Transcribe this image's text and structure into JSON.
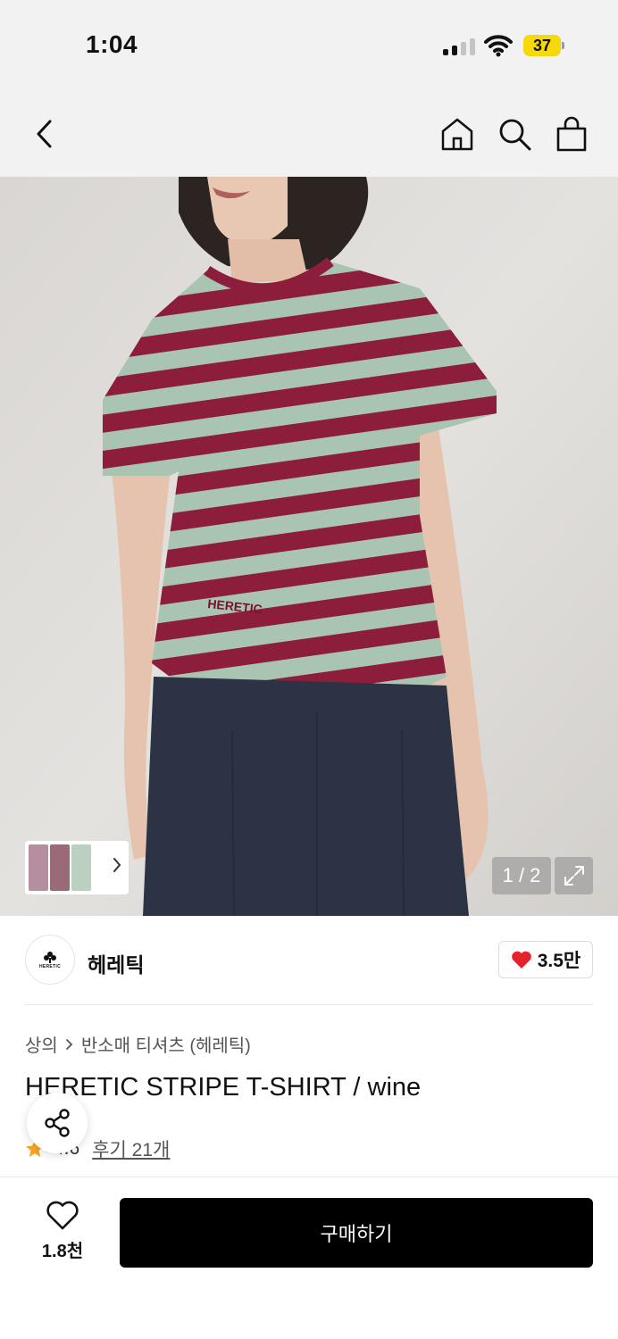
{
  "status_bar": {
    "time": "1:04",
    "battery": "37",
    "icons": [
      "cellular-signal-icon",
      "wifi-icon",
      "battery-icon"
    ]
  },
  "nav": {
    "icons": [
      "back-chevron-icon",
      "home-icon",
      "search-icon",
      "shopping-bag-icon"
    ]
  },
  "gallery": {
    "counter": "1 / 2",
    "current_page": 1,
    "total_pages": 2,
    "icons": [
      "thumbnail-next-chevron-icon",
      "expand-icon"
    ],
    "print_text": "HERETIC"
  },
  "brand": {
    "name": "헤레틱",
    "logo_text": "HERETIC",
    "like_count": "3.5만",
    "colors": {
      "heart": "#e5212b"
    }
  },
  "product": {
    "breadcrumb": [
      "상의",
      "반소매 티셔츠 (헤레틱)"
    ],
    "title": "HERETIC STRIPE T-SHIRT / wine",
    "rating": "4.6",
    "reviews": "후기 21개",
    "star_color": "#f5a623"
  },
  "bottom_bar": {
    "wish_count": "1.8천",
    "buy_label": "구매하기",
    "button_color": "#000000"
  }
}
